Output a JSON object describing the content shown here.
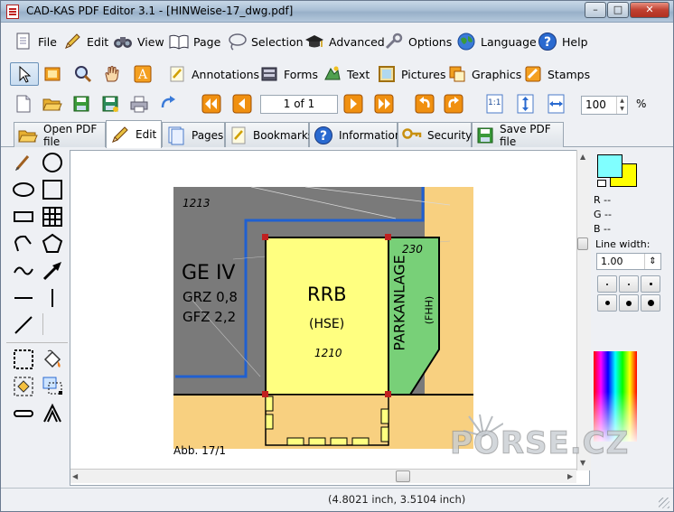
{
  "window": {
    "title": "CAD-KAS PDF Editor 3.1 - [HINWeise-17_dwg.pdf]",
    "min_glyph": "–",
    "max_glyph": "□",
    "close_glyph": "✕"
  },
  "menu": {
    "items": [
      {
        "label": "File"
      },
      {
        "label": "Edit"
      },
      {
        "label": "View"
      },
      {
        "label": "Page"
      },
      {
        "label": "Selection"
      },
      {
        "label": "Advanced"
      },
      {
        "label": "Options"
      },
      {
        "label": "Language"
      },
      {
        "label": "Help"
      }
    ]
  },
  "toolbar": {
    "annotations": "Annotations",
    "forms": "Forms",
    "text": "Text",
    "pictures": "Pictures",
    "graphics": "Graphics",
    "stamps": "Stamps",
    "page_value": "1 of 1",
    "zoom_value": "100",
    "zoom_unit": "%",
    "actual_size": "1:1"
  },
  "tabs": [
    {
      "label": "Open PDF file"
    },
    {
      "label": "Edit"
    },
    {
      "label": "Pages"
    },
    {
      "label": "Bookmarks"
    },
    {
      "label": "Information"
    },
    {
      "label": "Security"
    },
    {
      "label": "Save PDF file"
    }
  ],
  "drawing": {
    "lot_top": "1213",
    "zone": "GE IV",
    "grz": "GRZ 0,8",
    "gfz": "GFZ 2,2",
    "rrb": "RRB",
    "hse": "(HSE)",
    "lot_mid": "1210",
    "parkanlage": "PARKANLAGE",
    "fhh": "(FHH)",
    "lot_right": "230",
    "caption": "Abb. 17/1"
  },
  "rightpanel": {
    "r": "R --",
    "g": "G --",
    "b": "B --",
    "line_width_label": "Line width:",
    "line_width_value": "1.00",
    "fg_color": "#80ffff",
    "bg_color": "#ffff00"
  },
  "status": {
    "coords": "(4.8021 inch, 3.5104 inch)"
  },
  "watermark": "PORSE.CZ"
}
